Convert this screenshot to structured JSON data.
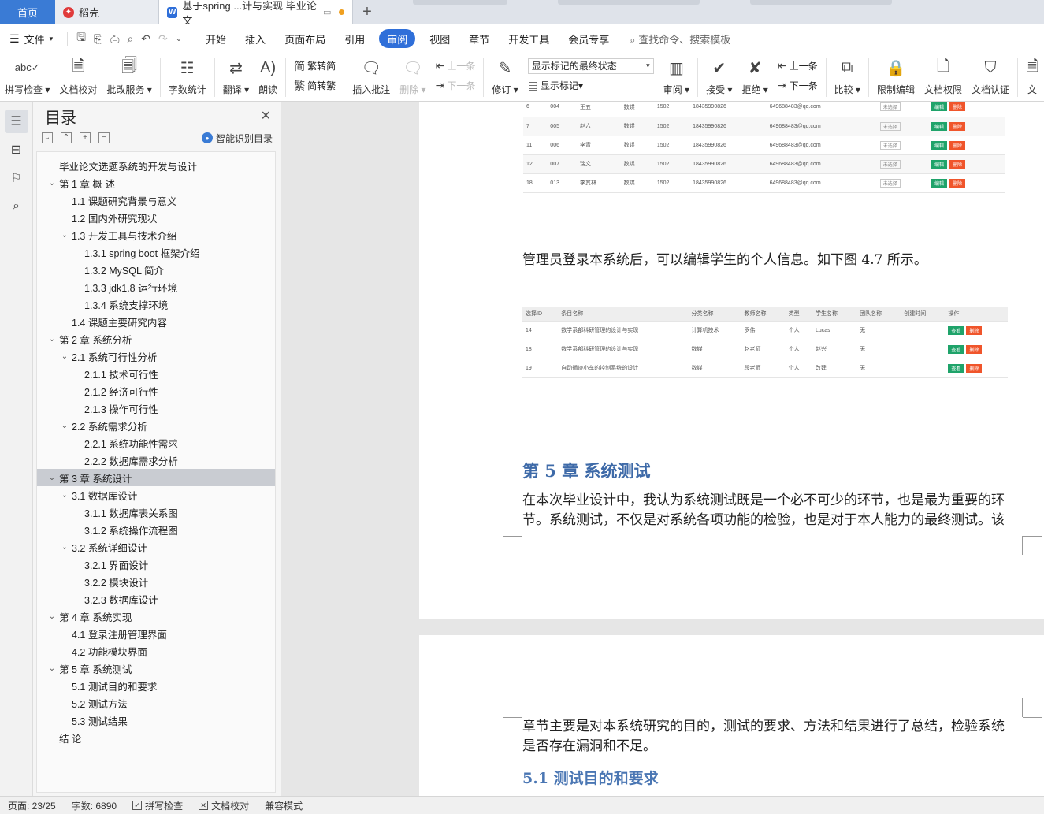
{
  "tabs": {
    "home": "首页",
    "daoke": "稻壳",
    "doc": "基于spring ...计与实现 毕业论文",
    "add": "+"
  },
  "menu": {
    "file": "文件",
    "items": [
      "开始",
      "插入",
      "页面布局",
      "引用",
      "审阅",
      "视图",
      "章节",
      "开发工具",
      "会员专享"
    ],
    "active": "审阅",
    "search": "查找命令、搜索模板"
  },
  "ribbon": {
    "spell": "拼写检查",
    "doc_check": "文档校对",
    "batch": "批改服务",
    "word_count": "字数统计",
    "translate": "翻译",
    "read": "朗读",
    "to_trad": "繁转简",
    "to_simp": "简转繁",
    "insert_comment": "插入批注",
    "delete": "删除",
    "prev": "上一条",
    "next": "下一条",
    "revise": "修订",
    "markup_state": "显示标记的最终状态",
    "show_markup": "显示标记",
    "review": "审阅",
    "accept": "接受",
    "reject": "拒绝",
    "prev2": "上一条",
    "next2": "下一条",
    "compare": "比较",
    "restrict": "限制编辑",
    "doc_perm": "文档权限",
    "doc_auth": "文档认证",
    "more": "文"
  },
  "toc": {
    "title": "目录",
    "smart": "智能识别目录",
    "items": [
      {
        "text": "毕业论文选题系统的开发与设计",
        "level": 0,
        "caret": ""
      },
      {
        "text": "第 1 章 概 述",
        "level": 0,
        "caret": "v"
      },
      {
        "text": "1.1 课题研究背景与意义",
        "level": 1,
        "caret": ""
      },
      {
        "text": "1.2 国内外研究现状",
        "level": 1,
        "caret": ""
      },
      {
        "text": "1.3 开发工具与技术介绍",
        "level": 1,
        "caret": "v"
      },
      {
        "text": "1.3.1 spring boot 框架介绍",
        "level": 2,
        "caret": ""
      },
      {
        "text": "1.3.2 MySQL 简介",
        "level": 2,
        "caret": ""
      },
      {
        "text": "1.3.3 jdk1.8 运行环境",
        "level": 2,
        "caret": ""
      },
      {
        "text": "1.3.4 系统支撑环境",
        "level": 2,
        "caret": ""
      },
      {
        "text": "1.4 课题主要研究内容",
        "level": 1,
        "caret": ""
      },
      {
        "text": "第 2 章 系统分析",
        "level": 0,
        "caret": "v"
      },
      {
        "text": "2.1 系统可行性分析",
        "level": 1,
        "caret": "v"
      },
      {
        "text": "2.1.1 技术可行性",
        "level": 2,
        "caret": ""
      },
      {
        "text": "2.1.2 经济可行性",
        "level": 2,
        "caret": ""
      },
      {
        "text": "2.1.3 操作可行性",
        "level": 2,
        "caret": ""
      },
      {
        "text": "2.2 系统需求分析",
        "level": 1,
        "caret": "v"
      },
      {
        "text": "2.2.1 系统功能性需求",
        "level": 2,
        "caret": ""
      },
      {
        "text": "2.2.2 数据库需求分析",
        "level": 2,
        "caret": ""
      },
      {
        "text": "第 3 章 系统设计",
        "level": 0,
        "caret": "v",
        "selected": true
      },
      {
        "text": "3.1 数据库设计",
        "level": 1,
        "caret": "v"
      },
      {
        "text": "3.1.1 数据库表关系图",
        "level": 2,
        "caret": ""
      },
      {
        "text": "3.1.2 系统操作流程图",
        "level": 2,
        "caret": ""
      },
      {
        "text": "3.2 系统详细设计",
        "level": 1,
        "caret": "v"
      },
      {
        "text": "3.2.1 界面设计",
        "level": 2,
        "caret": ""
      },
      {
        "text": "3.2.2 模块设计",
        "level": 2,
        "caret": ""
      },
      {
        "text": "3.2.3 数据库设计",
        "level": 2,
        "caret": ""
      },
      {
        "text": "第 4 章 系统实现",
        "level": 0,
        "caret": "v"
      },
      {
        "text": "4.1 登录注册管理界面",
        "level": 1,
        "caret": ""
      },
      {
        "text": "4.2 功能模块界面",
        "level": 1,
        "caret": ""
      },
      {
        "text": "第 5 章 系统测试",
        "level": 0,
        "caret": "v"
      },
      {
        "text": "5.1 测试目的和要求",
        "level": 1,
        "caret": ""
      },
      {
        "text": "5.2 测试方法",
        "level": 1,
        "caret": ""
      },
      {
        "text": "5.3 测试结果",
        "level": 1,
        "caret": ""
      },
      {
        "text": "结 论",
        "level": 0,
        "caret": ""
      }
    ]
  },
  "doc": {
    "table1_rows": [
      [
        "6",
        "004",
        "王五",
        "数媒",
        "1502",
        "18435990826",
        "649688483@qq.com"
      ],
      [
        "7",
        "005",
        "赵六",
        "数媒",
        "1502",
        "18435990826",
        "649688483@qq.com"
      ],
      [
        "11",
        "006",
        "李青",
        "数媒",
        "1502",
        "18435990826",
        "649688483@qq.com"
      ],
      [
        "12",
        "007",
        "瑞文",
        "数媒",
        "1502",
        "18435990826",
        "649688483@qq.com"
      ],
      [
        "18",
        "013",
        "李其林",
        "数媒",
        "1502",
        "18435990826",
        "649688483@qq.com"
      ]
    ],
    "table1_check": "未选择",
    "btn_edit": "编辑",
    "btn_delete": "删除",
    "para1": "管理员登录本系统后，可以编辑学生的个人信息。如下图 4.7 所示。",
    "table2_headers": [
      "选择ID",
      "条目名称",
      "分类名称",
      "教师名称",
      "类型",
      "学生名称",
      "团队名称",
      "创建时间",
      "操作"
    ],
    "table2_rows": [
      [
        "14",
        "数学系部科研管理的设计与实现",
        "计算机技术",
        "罗伟",
        "个人",
        "Lucas",
        "无",
        ""
      ],
      [
        "18",
        "数学系部科研管理的设计与实现",
        "数媒",
        "赵老师",
        "个人",
        "赵兴",
        "无",
        ""
      ],
      [
        "19",
        "自动循迹小车的控制系统的设计",
        "数媒",
        "段老师",
        "个人",
        "改建",
        "无",
        ""
      ]
    ],
    "btn_view": "查看",
    "chapter5": "第 5 章 系统测试",
    "para2_line1": "在本次毕业设计中，我认为系统测试既是一个必不可少的环节，也是最为重要的环",
    "para2_line2": "节。系统测试，不仅是对系统各项功能的检验，也是对于本人能力的最终测试。该",
    "para3_line1": "章节主要是对本系统研究的目的，测试的要求、方法和结果进行了总结，检验系统",
    "para3_line2": "是否存在漏洞和不足。",
    "sec51": "5.1 测试目的和要求"
  },
  "status": {
    "page": "页面: 23/25",
    "words": "字数: 6890",
    "spell": "拼写检查",
    "check": "文档校对",
    "compat": "兼容模式"
  },
  "colors": {
    "accent": "#2f6fd9",
    "heading": "#3e6aa8",
    "btn_green": "#1fa36a",
    "btn_red": "#f0552b"
  }
}
